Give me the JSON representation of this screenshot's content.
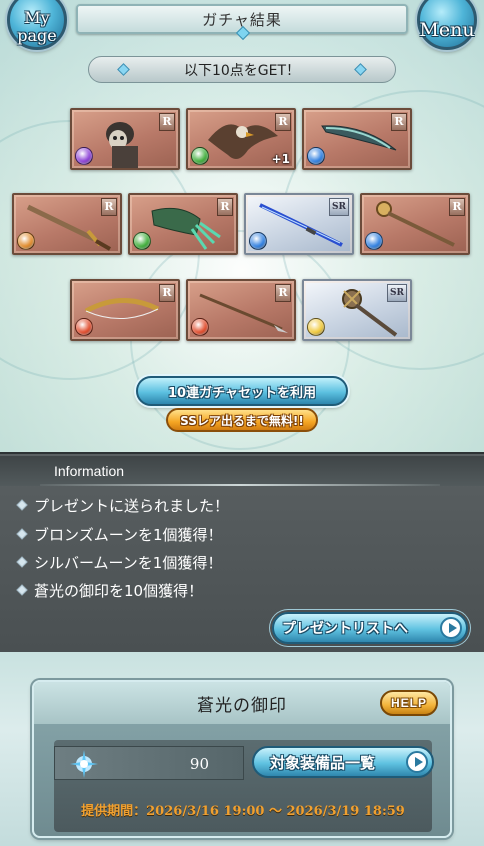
{
  "header": {
    "title": "ガチャ結果",
    "mypage_label": "My page",
    "menu_label": "Menu"
  },
  "banner": {
    "text": "以下10点をGET！"
  },
  "items": [
    {
      "rarity": "R",
      "element": "dark",
      "element_color": "#8b3fd6",
      "depicts": "skull-knight",
      "plus": ""
    },
    {
      "rarity": "R",
      "element": "wind",
      "element_color": "#3fae3a",
      "depicts": "griffin",
      "plus": "+1"
    },
    {
      "rarity": "R",
      "element": "water",
      "element_color": "#2f7fe0",
      "depicts": "curved-blade",
      "plus": ""
    },
    {
      "rarity": "R",
      "element": "fire",
      "element_color": "#e08a2a",
      "depicts": "sword",
      "plus": ""
    },
    {
      "rarity": "R",
      "element": "wind",
      "element_color": "#3fae3a",
      "depicts": "gauntlet",
      "plus": ""
    },
    {
      "rarity": "SR",
      "element": "water",
      "element_color": "#2f7fe0",
      "depicts": "katana",
      "plus": ""
    },
    {
      "rarity": "R",
      "element": "water",
      "element_color": "#2f7fe0",
      "depicts": "staff",
      "plus": ""
    },
    {
      "rarity": "R",
      "element": "fire",
      "element_color": "#e04a2a",
      "depicts": "bow",
      "plus": ""
    },
    {
      "rarity": "R",
      "element": "fire",
      "element_color": "#e04a2a",
      "depicts": "spear",
      "plus": ""
    },
    {
      "rarity": "SR",
      "element": "light",
      "element_color": "#f0c93a",
      "depicts": "scepter",
      "plus": ""
    }
  ],
  "gacha": {
    "button_label": "10連ガチャセットを利用",
    "badge_label": "SSレア出るまで無料!!"
  },
  "information": {
    "heading": "Information",
    "lines": [
      "プレゼントに送られました！",
      "ブロンズムーンを1個獲得！",
      "シルバームーンを1個獲得！",
      "蒼光の御印を10個獲得！"
    ],
    "present_button": "プレゼントリストへ"
  },
  "seal": {
    "title": "蒼光の御印",
    "help_label": "HELP",
    "count": "90",
    "equip_button": "対象装備品一覧",
    "period": "提供期間：2026/3/16 19:00 〜 2026/3/19 18:59"
  }
}
